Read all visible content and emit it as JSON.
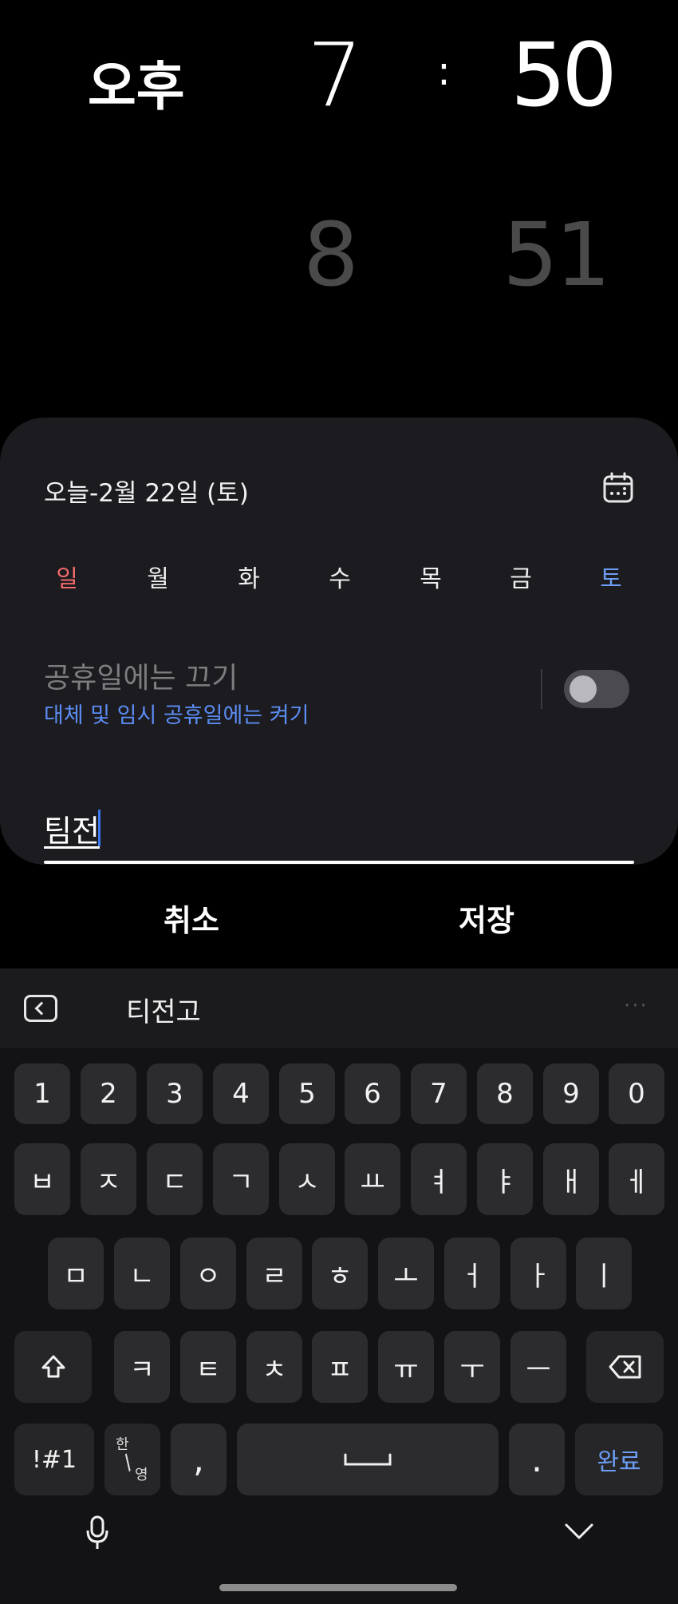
{
  "time": {
    "ampm": "오후",
    "hour": "7",
    "separator": ":",
    "minute": "50",
    "next_hour": "8",
    "next_minute": "51"
  },
  "date": {
    "label": "오늘-2월 22일 (토)"
  },
  "weekdays": [
    "일",
    "월",
    "화",
    "수",
    "목",
    "금",
    "토"
  ],
  "holiday": {
    "title": "공휴일에는 끄기",
    "subtitle": "대체 및 임시 공휴일에는 켜기",
    "enabled": false
  },
  "alarm_name": {
    "value": "팀전"
  },
  "actions": {
    "cancel": "취소",
    "save": "저장"
  },
  "keyboard": {
    "suggestion": "티전고",
    "more": "···",
    "numbers": [
      "1",
      "2",
      "3",
      "4",
      "5",
      "6",
      "7",
      "8",
      "9",
      "0"
    ],
    "row1": [
      "ㅂ",
      "ㅈ",
      "ㄷ",
      "ㄱ",
      "ㅅ",
      "ㅛ",
      "ㅕ",
      "ㅑ",
      "ㅐ",
      "ㅔ"
    ],
    "row2": [
      "ㅁ",
      "ㄴ",
      "ㅇ",
      "ㄹ",
      "ㅎ",
      "ㅗ",
      "ㅓ",
      "ㅏ",
      "ㅣ"
    ],
    "row3": [
      "ㅋ",
      "ㅌ",
      "ㅊ",
      "ㅍ",
      "ㅠ",
      "ㅜ",
      "ㅡ"
    ],
    "symbols": "!#1",
    "lang_top": "한",
    "lang_bottom": "영",
    "comma": ",",
    "period": ".",
    "done": "완료"
  },
  "colors": {
    "accent": "#5b8df2",
    "sunday": "#ef6a6a",
    "saturday": "#6d9ef5",
    "card": "#1c1b20"
  }
}
